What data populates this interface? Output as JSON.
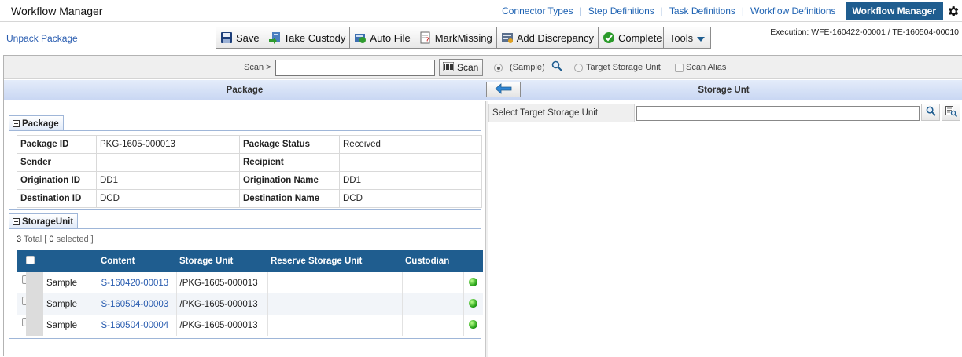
{
  "app": {
    "title": "Workflow Manager"
  },
  "nav": {
    "links": [
      "Connector Types",
      "Step Definitions",
      "Task Definitions",
      "Workflow Definitions"
    ],
    "separator": "|",
    "active": "Workflow Manager",
    "settings_icon": "gear-icon"
  },
  "page": {
    "name": "Unpack Package"
  },
  "toolbar": {
    "save": "Save",
    "take_custody": "Take Custody",
    "auto_file": "Auto File",
    "mark_missing": "MarkMissing",
    "add_discrepancy": "Add Discrepancy",
    "complete": "Complete",
    "tools": "Tools"
  },
  "execution": "Execution: WFE-160422-00001 / TE-160504-00010",
  "scan": {
    "label": "Scan >",
    "value": "",
    "button": "Scan",
    "option_sample": "(Sample)",
    "option_target": "Target Storage Unit",
    "option_alias": "Scan Alias"
  },
  "left_panel": {
    "title": "Package"
  },
  "right_panel": {
    "title": "Storage Unt"
  },
  "package_group": {
    "title": "Package",
    "rows": [
      {
        "k1": "Package ID",
        "v1": "PKG-1605-000013",
        "k2": "Package Status",
        "v2": "Received"
      },
      {
        "k1": "Sender",
        "v1": "",
        "k2": "Recipient",
        "v2": ""
      },
      {
        "k1": "Origination ID",
        "v1": "DD1",
        "k2": "Origination Name",
        "v2": "DD1"
      },
      {
        "k1": "Destination ID",
        "v1": "DCD",
        "k2": "Destination Name",
        "v2": "DCD"
      }
    ]
  },
  "storage_group": {
    "title": "StorageUnit",
    "total_count": "3",
    "total_label": "Total [",
    "selected_count": "0",
    "selected_label": "selected ]",
    "columns": [
      "Content",
      "Storage Unit",
      "Reserve Storage Unit",
      "Custodian"
    ],
    "rows": [
      {
        "type": "Sample",
        "content": "S-160420-00013",
        "storage_unit": "/PKG-1605-000013",
        "reserve": "",
        "custodian": ""
      },
      {
        "type": "Sample",
        "content": "S-160504-00003",
        "storage_unit": "/PKG-1605-000013",
        "reserve": "",
        "custodian": ""
      },
      {
        "type": "Sample",
        "content": "S-160504-00004",
        "storage_unit": "/PKG-1605-000013",
        "reserve": "",
        "custodian": ""
      }
    ]
  },
  "target": {
    "label": "Select Target Storage Unit",
    "value": ""
  },
  "colors": {
    "nav_active": "#1f5d8f",
    "grid_header": "#1f5d8f",
    "link": "#2a5db0",
    "panel_header": "#c9d7f3"
  }
}
